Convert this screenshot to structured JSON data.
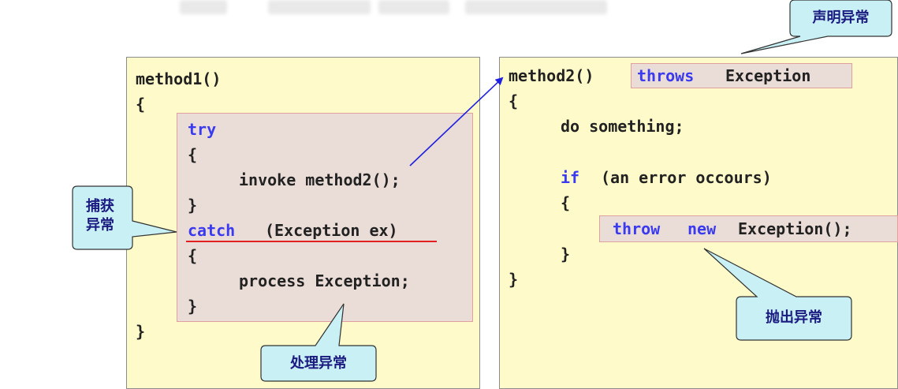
{
  "left_panel": {
    "lines": [
      "method1()",
      "{",
      "try",
      "{",
      "invoke method2();",
      "}",
      "catch",
      "(Exception ex)",
      "{",
      "process Exception;",
      "}",
      "}"
    ]
  },
  "right_panel": {
    "lines": [
      "method2()",
      "throws",
      "Exception",
      "{",
      "do something;",
      "if",
      "(an error occours)",
      "{",
      "throw",
      "new",
      "Exception();",
      "}",
      "}"
    ]
  },
  "callouts": {
    "declare": "声明异常",
    "catch_line1": "捕获",
    "catch_line2": "异常",
    "handle": "处理异常",
    "throw": "抛出异常"
  },
  "colors": {
    "panel_bg": "#fefac9",
    "keyword": "#3a3af0",
    "highlight_bg": "#eadcd6",
    "callout_fill": "#c8f0f5",
    "arrow": "#2020e0",
    "underline": "#e02020"
  }
}
